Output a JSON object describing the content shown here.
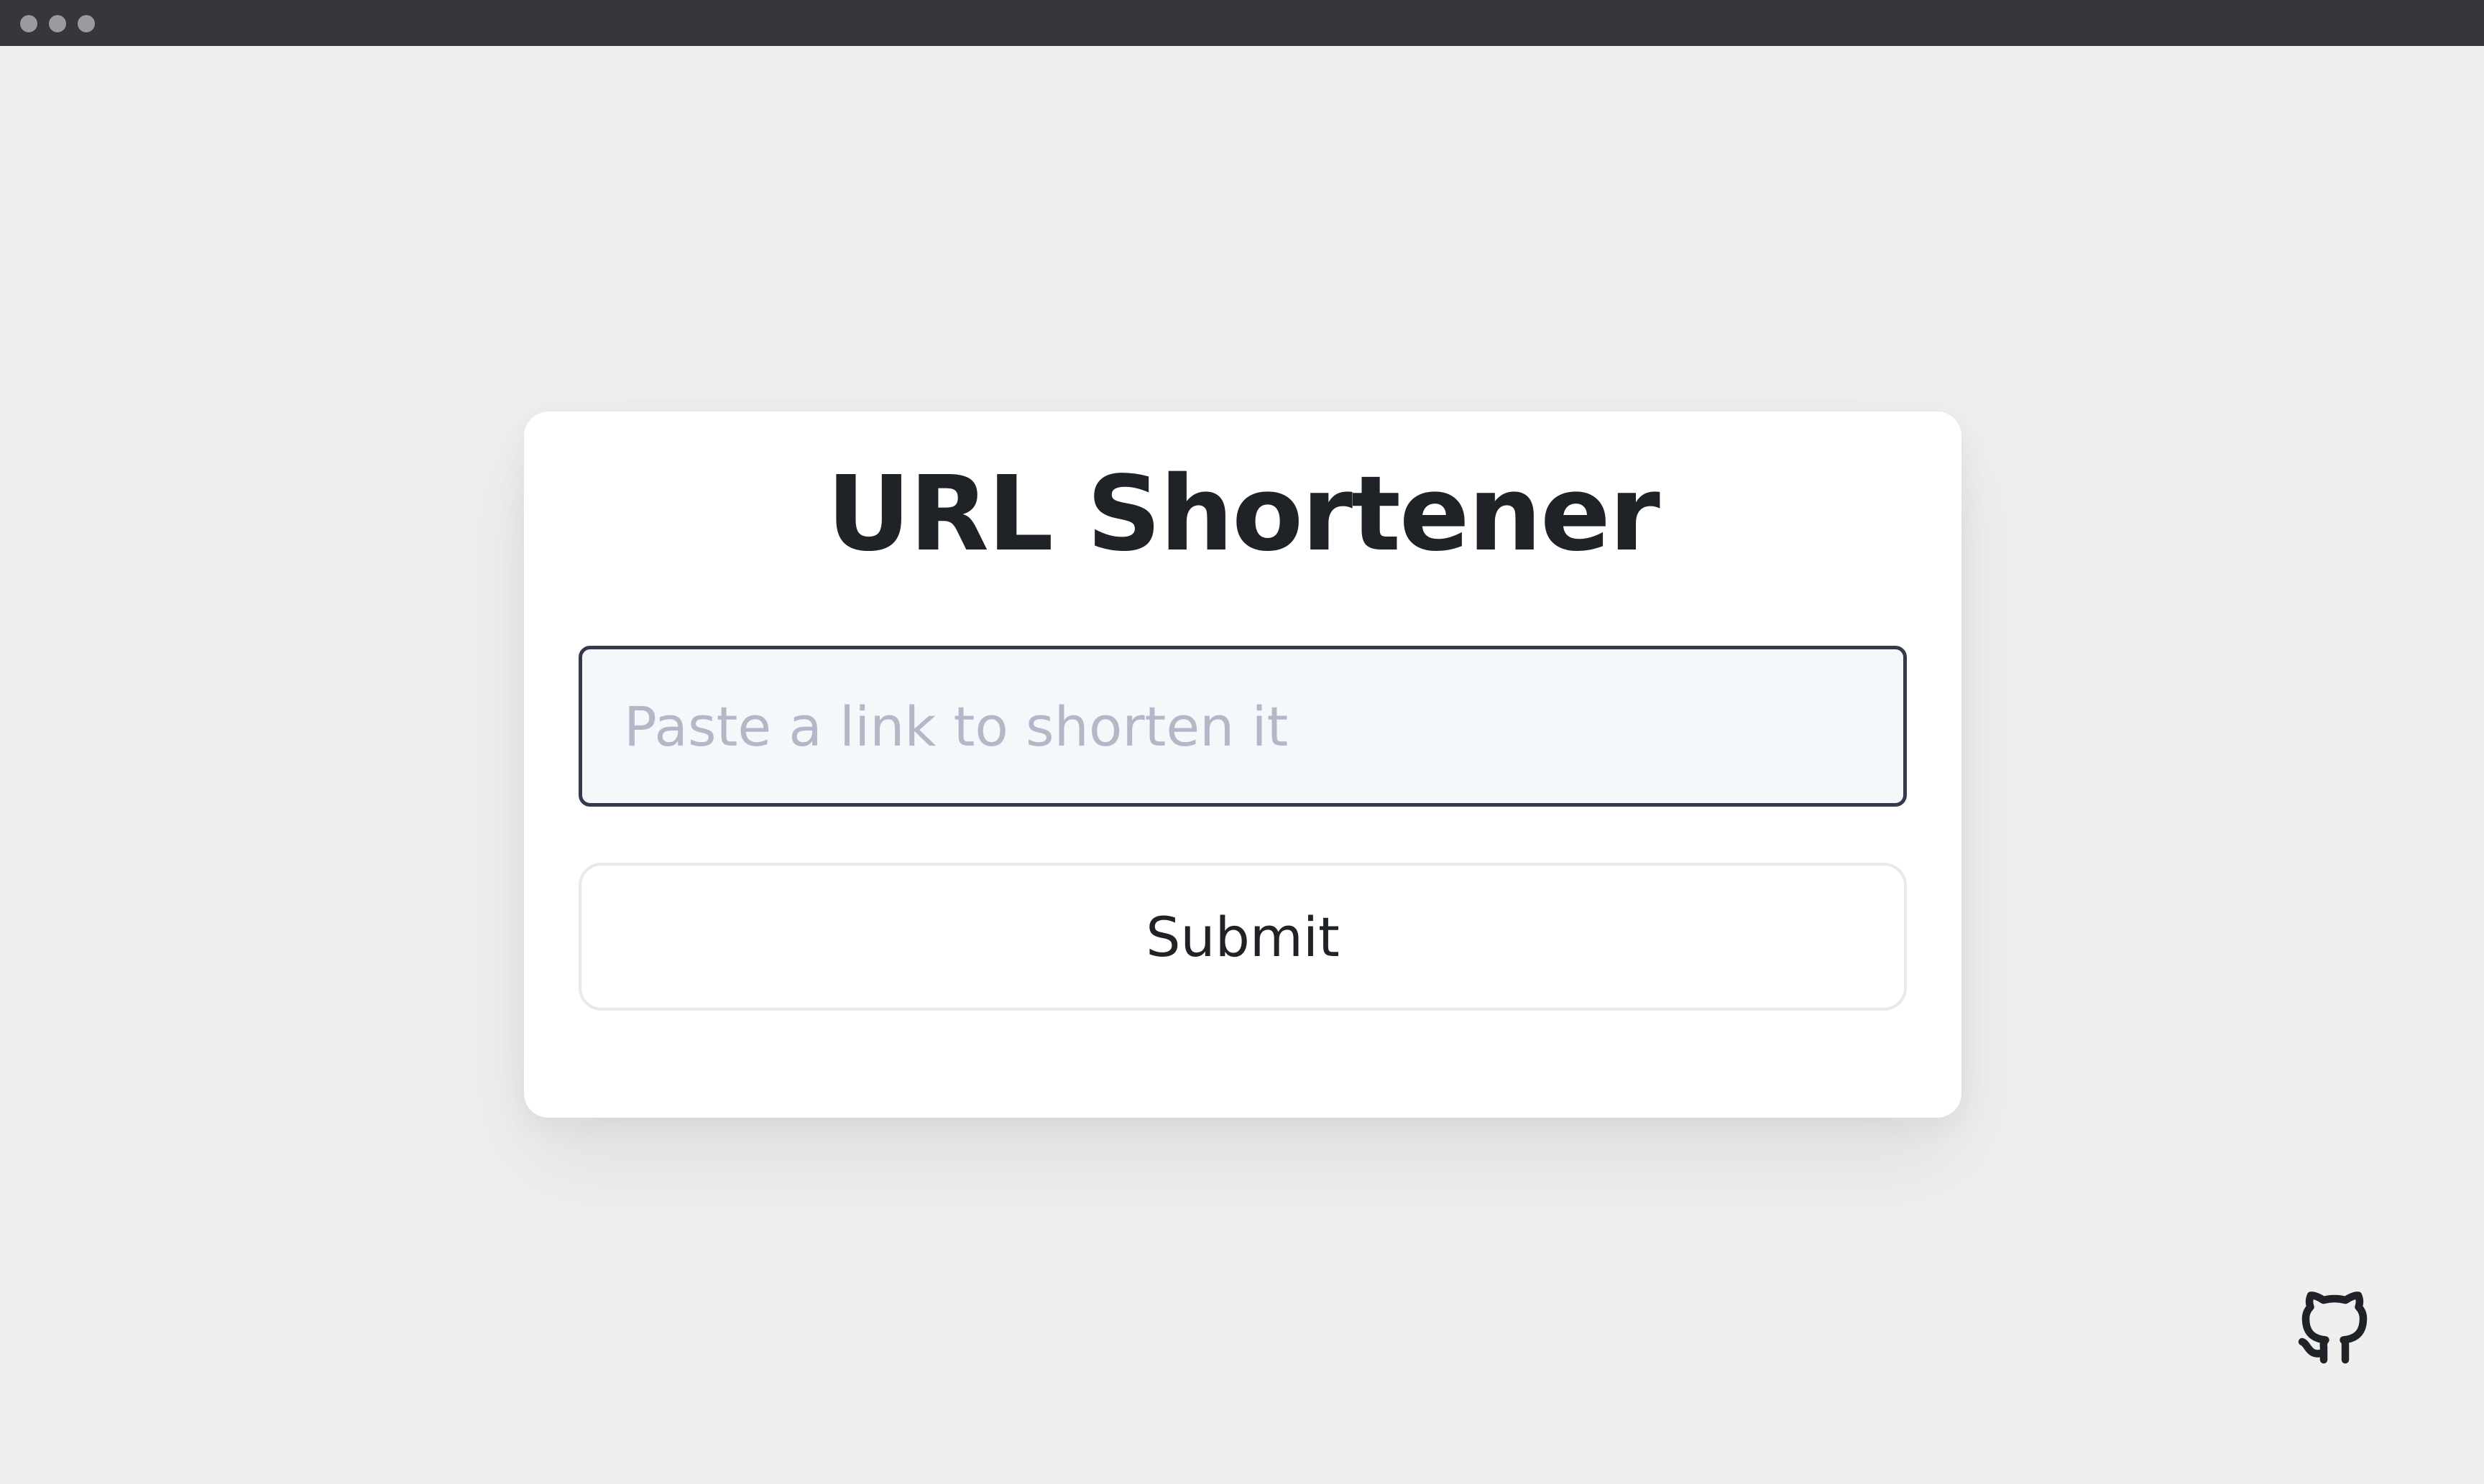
{
  "window": {
    "controls": [
      "close",
      "minimize",
      "maximize"
    ]
  },
  "card": {
    "title": "URL Shortener"
  },
  "form": {
    "input_value": "",
    "input_placeholder": "Paste a link to shorten it",
    "submit_label": "Submit"
  },
  "footer": {
    "github_icon": "github-icon"
  },
  "colors": {
    "page_background": "#efefef",
    "titlebar": "#36373a",
    "card_background": "#ffffff",
    "title_text": "#1f2328",
    "input_background": "#f5f8fb",
    "input_border": "#343a4c",
    "placeholder_text": "#b3b8c8",
    "button_border": "#e8e9ec"
  }
}
